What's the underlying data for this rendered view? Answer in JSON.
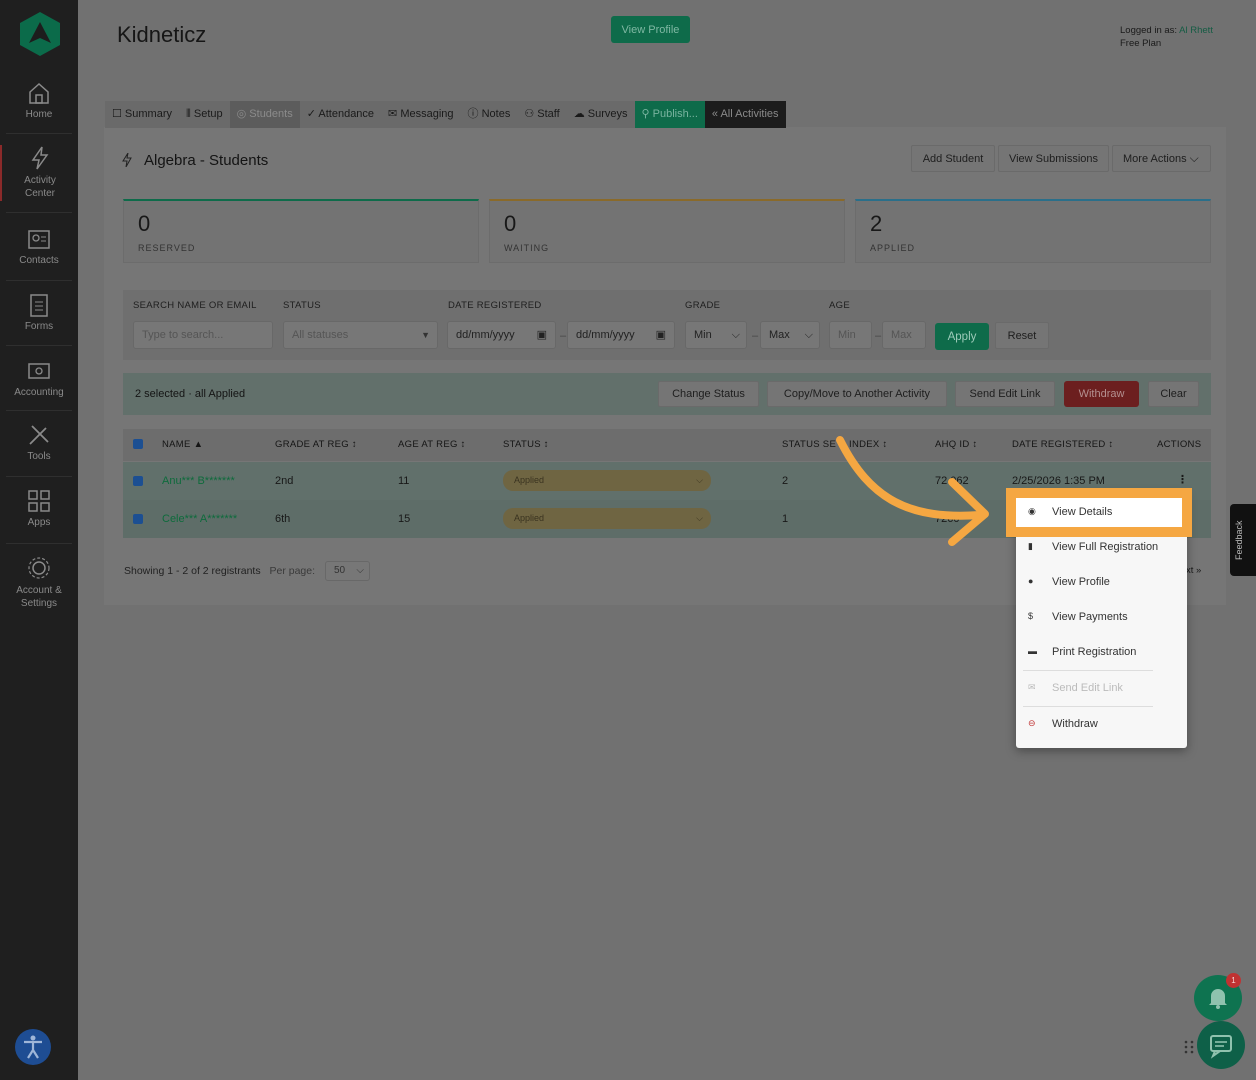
{
  "sidebar": {
    "items": [
      {
        "label": "Home",
        "icon": "home-icon"
      },
      {
        "label": "Activity Center",
        "icon": "lightning-icon"
      },
      {
        "label": "Contacts",
        "icon": "contacts-icon"
      },
      {
        "label": "Forms",
        "icon": "forms-icon"
      },
      {
        "label": "Accounting",
        "icon": "accounting-icon"
      },
      {
        "label": "Tools",
        "icon": "tools-icon"
      },
      {
        "label": "Apps",
        "icon": "apps-icon"
      },
      {
        "label": "Account & Settings",
        "icon": "gear-icon"
      }
    ]
  },
  "header": {
    "title": "Kidneticz",
    "view_profile": "View Profile",
    "logged_in_label": "Logged in as:",
    "user": "Al Rhett",
    "plan": "Free Plan"
  },
  "tabs": [
    {
      "label": "Summary",
      "icon": "summary-icon"
    },
    {
      "label": "Setup",
      "icon": "setup-icon"
    },
    {
      "label": "Students",
      "icon": "students-icon"
    },
    {
      "label": "Attendance",
      "icon": "check-icon"
    },
    {
      "label": "Messaging",
      "icon": "mail-icon"
    },
    {
      "label": "Notes",
      "icon": "notes-icon"
    },
    {
      "label": "Staff",
      "icon": "staff-icon"
    },
    {
      "label": "Surveys",
      "icon": "cloud-icon"
    },
    {
      "label": "Publish...",
      "icon": "link-icon"
    },
    {
      "label": "« All Activities",
      "icon": ""
    }
  ],
  "page": {
    "heading": "Algebra - Students",
    "add_student": "Add Student",
    "view_submissions": "View Submissions",
    "more_actions": "More Actions"
  },
  "stats": [
    {
      "value": "0",
      "label": "RESERVED",
      "color": "#0e6b4a"
    },
    {
      "value": "0",
      "label": "WAITING",
      "color": "#8a6a2a"
    },
    {
      "value": "2",
      "label": "APPLIED",
      "color": "#2a6f8a"
    }
  ],
  "filters": {
    "search_label": "SEARCH NAME OR EMAIL",
    "search_placeholder": "Type to search...",
    "status_label": "STATUS",
    "status_value": "All statuses",
    "date_label": "DATE REGISTERED",
    "date_from": "dd/mm/yyyy",
    "date_to": "dd/mm/yyyy",
    "grade_label": "GRADE",
    "grade_min": "Min",
    "grade_max": "Max",
    "age_label": "AGE",
    "age_min": "Min",
    "age_max": "Max",
    "apply": "Apply",
    "reset": "Reset"
  },
  "selection": {
    "text": "2 selected · all Applied",
    "change_status": "Change Status",
    "copy_move": "Copy/Move to Another Activity",
    "send_edit_link": "Send Edit Link",
    "withdraw": "Withdraw",
    "clear": "Clear"
  },
  "table": {
    "headers": [
      "NAME ▲",
      "GRADE AT REG ↕",
      "AGE AT REG ↕",
      "STATUS ↕",
      "STATUS SE",
      "INDEX ↕",
      "AHQ ID ↕",
      "DATE REGISTERED ↕",
      "ACTIONS"
    ],
    "rows": [
      {
        "name": "Anu*** B*******",
        "grade": "2nd",
        "age": "11",
        "status": "Applied",
        "seq": "2",
        "ahq": "72 062",
        "date": "2/25/2026 1:35 PM"
      },
      {
        "name": "Cele*** A*******",
        "grade": "6th",
        "age": "15",
        "status": "Applied",
        "seq": "1",
        "ahq": "7260",
        "date": ""
      }
    ]
  },
  "footer": {
    "showing": "Showing 1 - 2 of 2 registrants",
    "per_page_label": "Per page:",
    "per_page": "50",
    "next": "xt »"
  },
  "menu": {
    "items": [
      {
        "label": "View Details",
        "icon": "eye-icon"
      },
      {
        "label": "View Full Registration",
        "icon": "document-icon"
      },
      {
        "label": "View Profile",
        "icon": "user-icon"
      },
      {
        "label": "View Payments",
        "icon": "dollar-icon"
      },
      {
        "label": "Print Registration",
        "icon": "printer-icon"
      },
      {
        "label": "Send Edit Link",
        "icon": "envelope-icon"
      },
      {
        "label": "Withdraw",
        "icon": "minus-circle-icon"
      }
    ]
  },
  "widgets": {
    "feedback": "Feedback",
    "badge": "1"
  },
  "colors": {
    "accent_green": "#0e6b4a",
    "highlight": "#f5a742",
    "withdraw_red": "#6c1f1f"
  }
}
